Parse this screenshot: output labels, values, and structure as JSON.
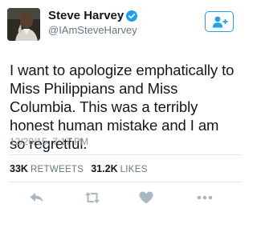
{
  "user": {
    "display_name": "Steve Harvey",
    "handle": "@IAmSteveHarvey",
    "avatar_icon": "profile-photo",
    "verified_icon": "verified-badge-icon"
  },
  "follow": {
    "icon": "add-user-icon"
  },
  "tweet": {
    "text": "I want to apologize emphatically to Miss Philippians and Miss Columbia. This was a terribly honest human mistake and I am so regretful.",
    "timestamp": "12/20/15, 7:17 PM"
  },
  "stats": {
    "retweets_count": "33K",
    "retweets_label": "RETWEETS",
    "likes_count": "31.2K",
    "likes_label": "LIKES"
  },
  "actions": {
    "reply_icon": "reply-icon",
    "retweet_icon": "retweet-icon",
    "like_icon": "heart-icon",
    "more_icon": "more-icon"
  },
  "colors": {
    "accent": "#1da1f2",
    "text": "#14171a",
    "secondary": "#657786",
    "icon_gray": "#aab8c2"
  }
}
